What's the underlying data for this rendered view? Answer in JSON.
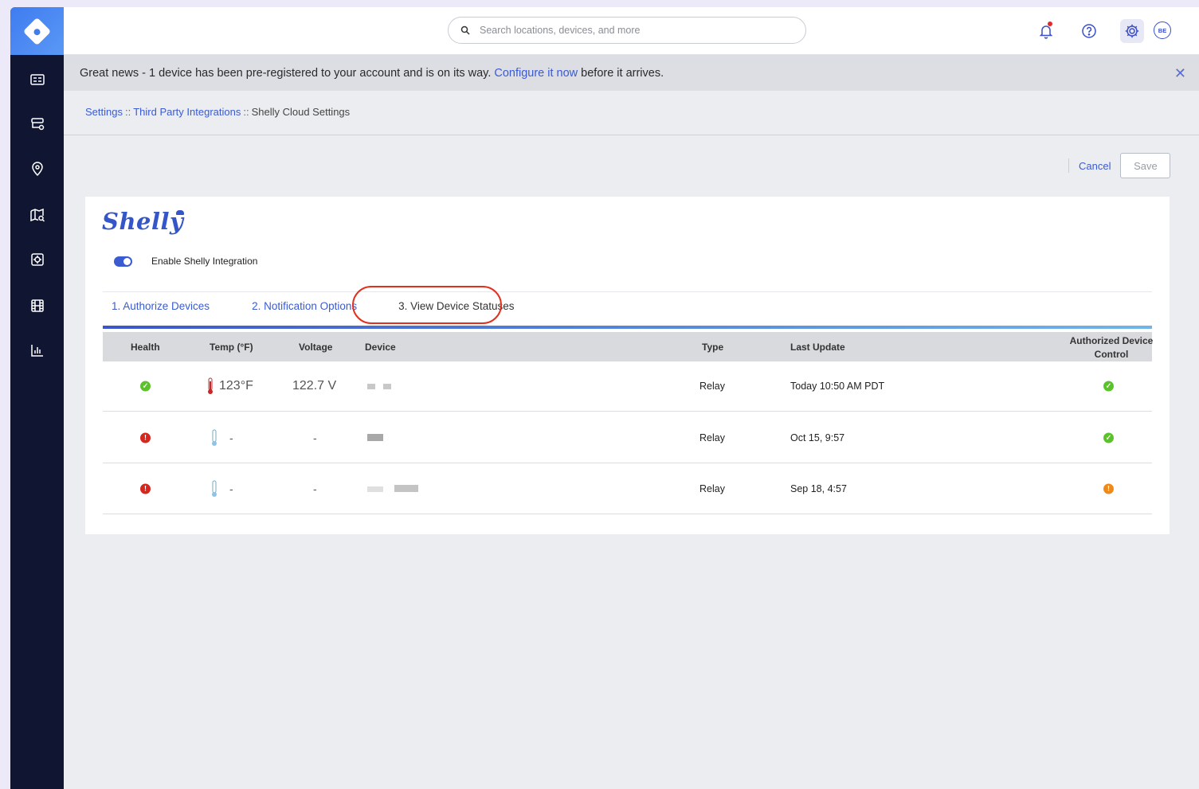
{
  "search": {
    "placeholder": "Search locations, devices, and more"
  },
  "user": {
    "initials": "BE"
  },
  "banner": {
    "text_before": "Great news - 1 device has been pre-registered to your account and is on its way.",
    "link": "Configure it now",
    "text_after": "before it arrives.",
    "close": "✕"
  },
  "breadcrumb": {
    "items": [
      "Settings",
      "Third Party Integrations",
      "Shelly Cloud Settings"
    ],
    "separator": "::"
  },
  "actions": {
    "cancel": "Cancel",
    "save": "Save"
  },
  "integration": {
    "logo_text": "Shelly",
    "toggle_label": "Enable Shelly Integration",
    "toggle_on": true
  },
  "tabs": [
    {
      "label": "1. Authorize Devices"
    },
    {
      "label": "2. Notification Options"
    },
    {
      "label": "3. View Device Statuses"
    }
  ],
  "table": {
    "headers": {
      "health": "Health",
      "temp": "Temp (°F)",
      "voltage": "Voltage",
      "device": "Device",
      "type": "Type",
      "last_update": "Last Update",
      "control_line1": "Authorized Device",
      "control_line2": "Control"
    },
    "rows": [
      {
        "health": "ok",
        "temp": "123°F",
        "voltage": "122.7 V",
        "type": "Relay",
        "last_update": "Today 10:50 AM PDT",
        "control": "ok"
      },
      {
        "health": "error",
        "temp": "-",
        "voltage": "-",
        "type": "Relay",
        "last_update": "Oct 15, 9:57",
        "control": "ok"
      },
      {
        "health": "error",
        "temp": "-",
        "voltage": "-",
        "type": "Relay",
        "last_update": "Sep 18, 4:57",
        "control": "warning"
      }
    ]
  },
  "colors": {
    "accent": "#3a5bd1",
    "sidebar": "#101632",
    "ok": "#5cc22c",
    "error": "#d7261e",
    "warning": "#ef8a19",
    "highlight": "#e0311f"
  }
}
